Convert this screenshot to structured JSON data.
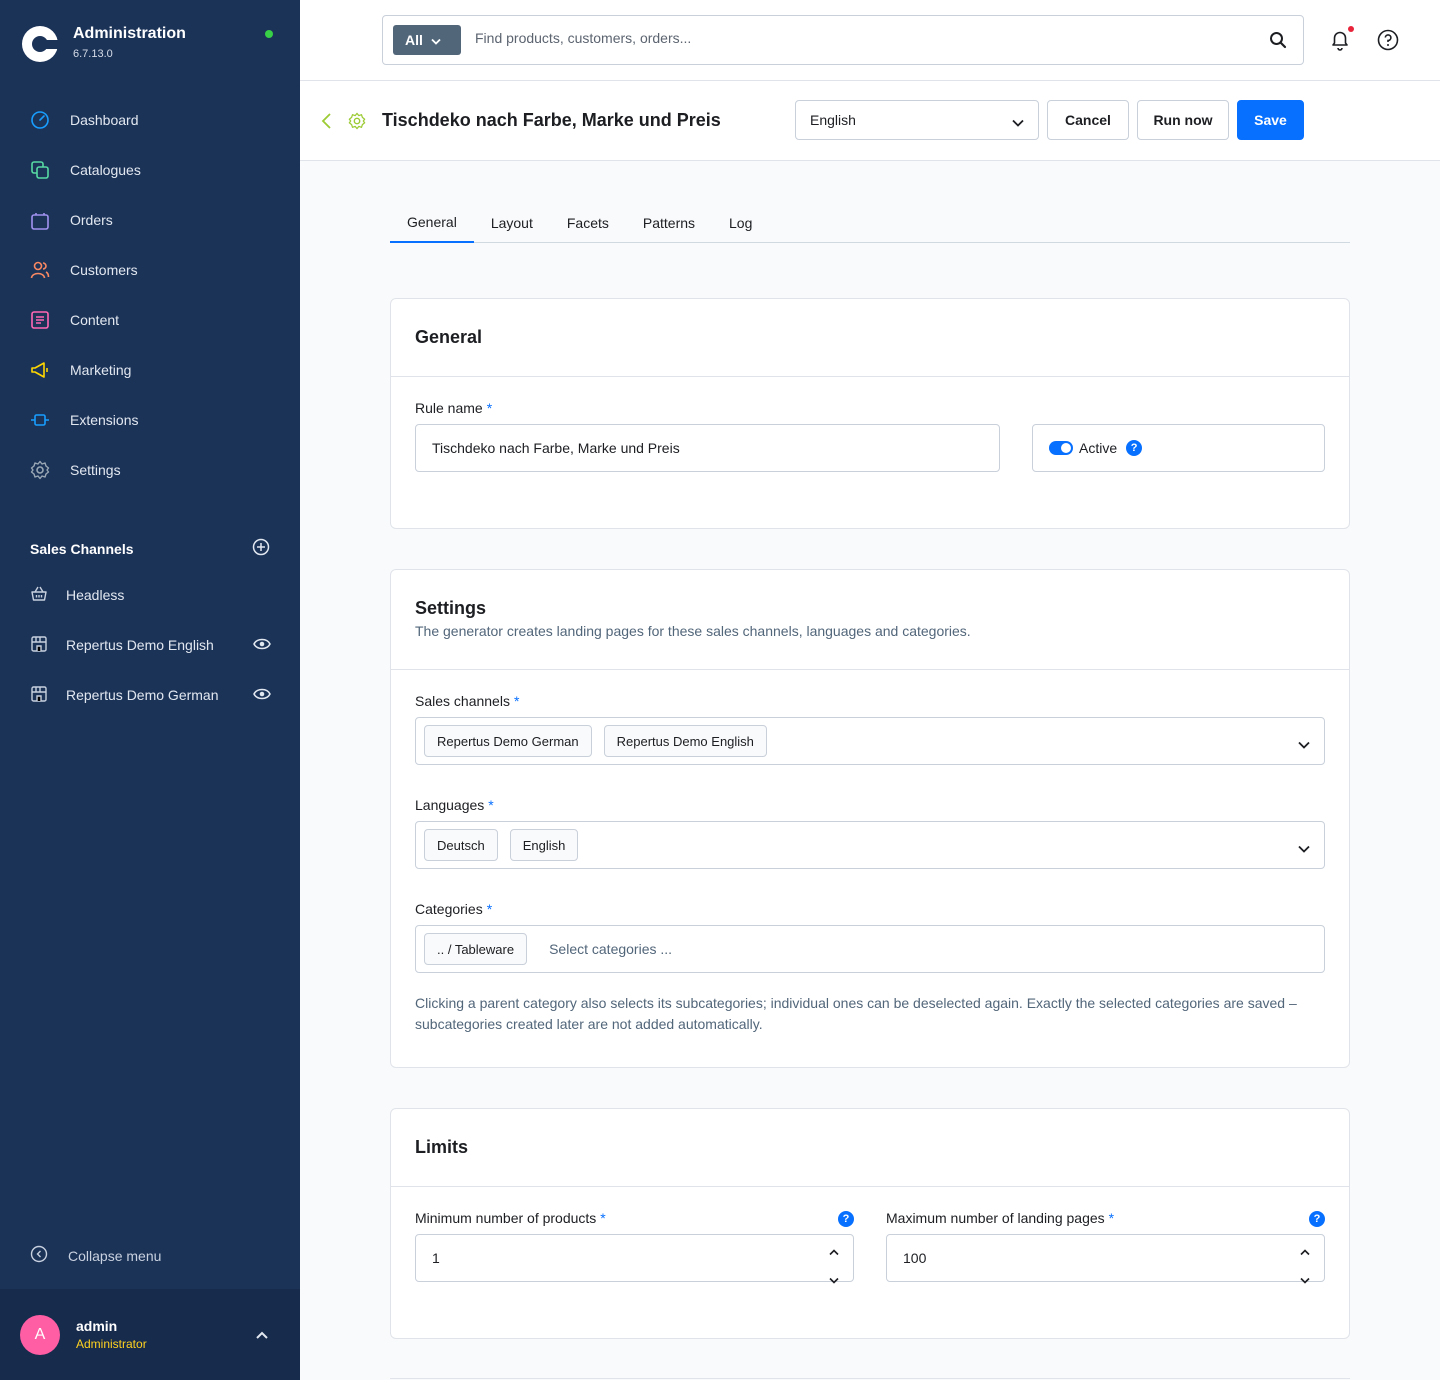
{
  "app": {
    "title": "Administration",
    "version": "6.7.13.0"
  },
  "nav": {
    "items": [
      {
        "label": "Dashboard",
        "icon": "dashboard-icon",
        "color": "#189eff"
      },
      {
        "label": "Catalogues",
        "icon": "catalogues-icon",
        "color": "#57d9a3"
      },
      {
        "label": "Orders",
        "icon": "orders-icon",
        "color": "#a092f0"
      },
      {
        "label": "Customers",
        "icon": "customers-icon",
        "color": "#f88962"
      },
      {
        "label": "Content",
        "icon": "content-icon",
        "color": "#ff68b4"
      },
      {
        "label": "Marketing",
        "icon": "marketing-icon",
        "color": "#ffd700"
      },
      {
        "label": "Extensions",
        "icon": "extensions-icon",
        "color": "#189eff"
      },
      {
        "label": "Settings",
        "icon": "settings-icon",
        "color": "#9aa8b5"
      }
    ]
  },
  "sales_channels": {
    "title": "Sales Channels",
    "items": [
      {
        "label": "Headless",
        "icon": "basket-icon"
      },
      {
        "label": "Repertus Demo English",
        "icon": "storefront-icon"
      },
      {
        "label": "Repertus Demo German",
        "icon": "storefront-icon"
      }
    ]
  },
  "collapse_label": "Collapse menu",
  "user": {
    "initial": "A",
    "name": "admin",
    "role": "Administrator"
  },
  "search": {
    "scope": "All",
    "placeholder": "Find products, customers, orders..."
  },
  "header": {
    "title": "Tischdeko nach Farbe, Marke und Preis",
    "language": "English",
    "cancel": "Cancel",
    "run_now": "Run now",
    "save": "Save"
  },
  "tabs": [
    "General",
    "Layout",
    "Facets",
    "Patterns",
    "Log"
  ],
  "general": {
    "title": "General",
    "rule_name_label": "Rule name",
    "required_marker": "*",
    "rule_name_value": "Tischdeko nach Farbe, Marke und Preis",
    "active_label": "Active",
    "active": true,
    "help_glyph": "?"
  },
  "settings": {
    "title": "Settings",
    "subtitle": "The generator creates landing pages for these sales channels, languages and categories.",
    "sales_channels_label": "Sales channels",
    "sales_channels": [
      "Repertus Demo German",
      "Repertus Demo English"
    ],
    "languages_label": "Languages",
    "languages": [
      "Deutsch",
      "English"
    ],
    "categories_label": "Categories",
    "categories": [
      ".. / Tableware"
    ],
    "categories_placeholder": "Select categories ...",
    "hint": "Clicking a parent category also selects its subcategories; individual ones can be deselected again. Exactly the selected categories are saved – subcategories created later are not added automatically."
  },
  "limits": {
    "title": "Limits",
    "min_products_label": "Minimum number of products",
    "min_products_value": "1",
    "max_pages_label": "Maximum number of landing pages",
    "max_pages_value": "100"
  },
  "colors": {
    "accent": "#0870ff",
    "sidebar": "#1c3358",
    "status_online": "#37d046"
  }
}
